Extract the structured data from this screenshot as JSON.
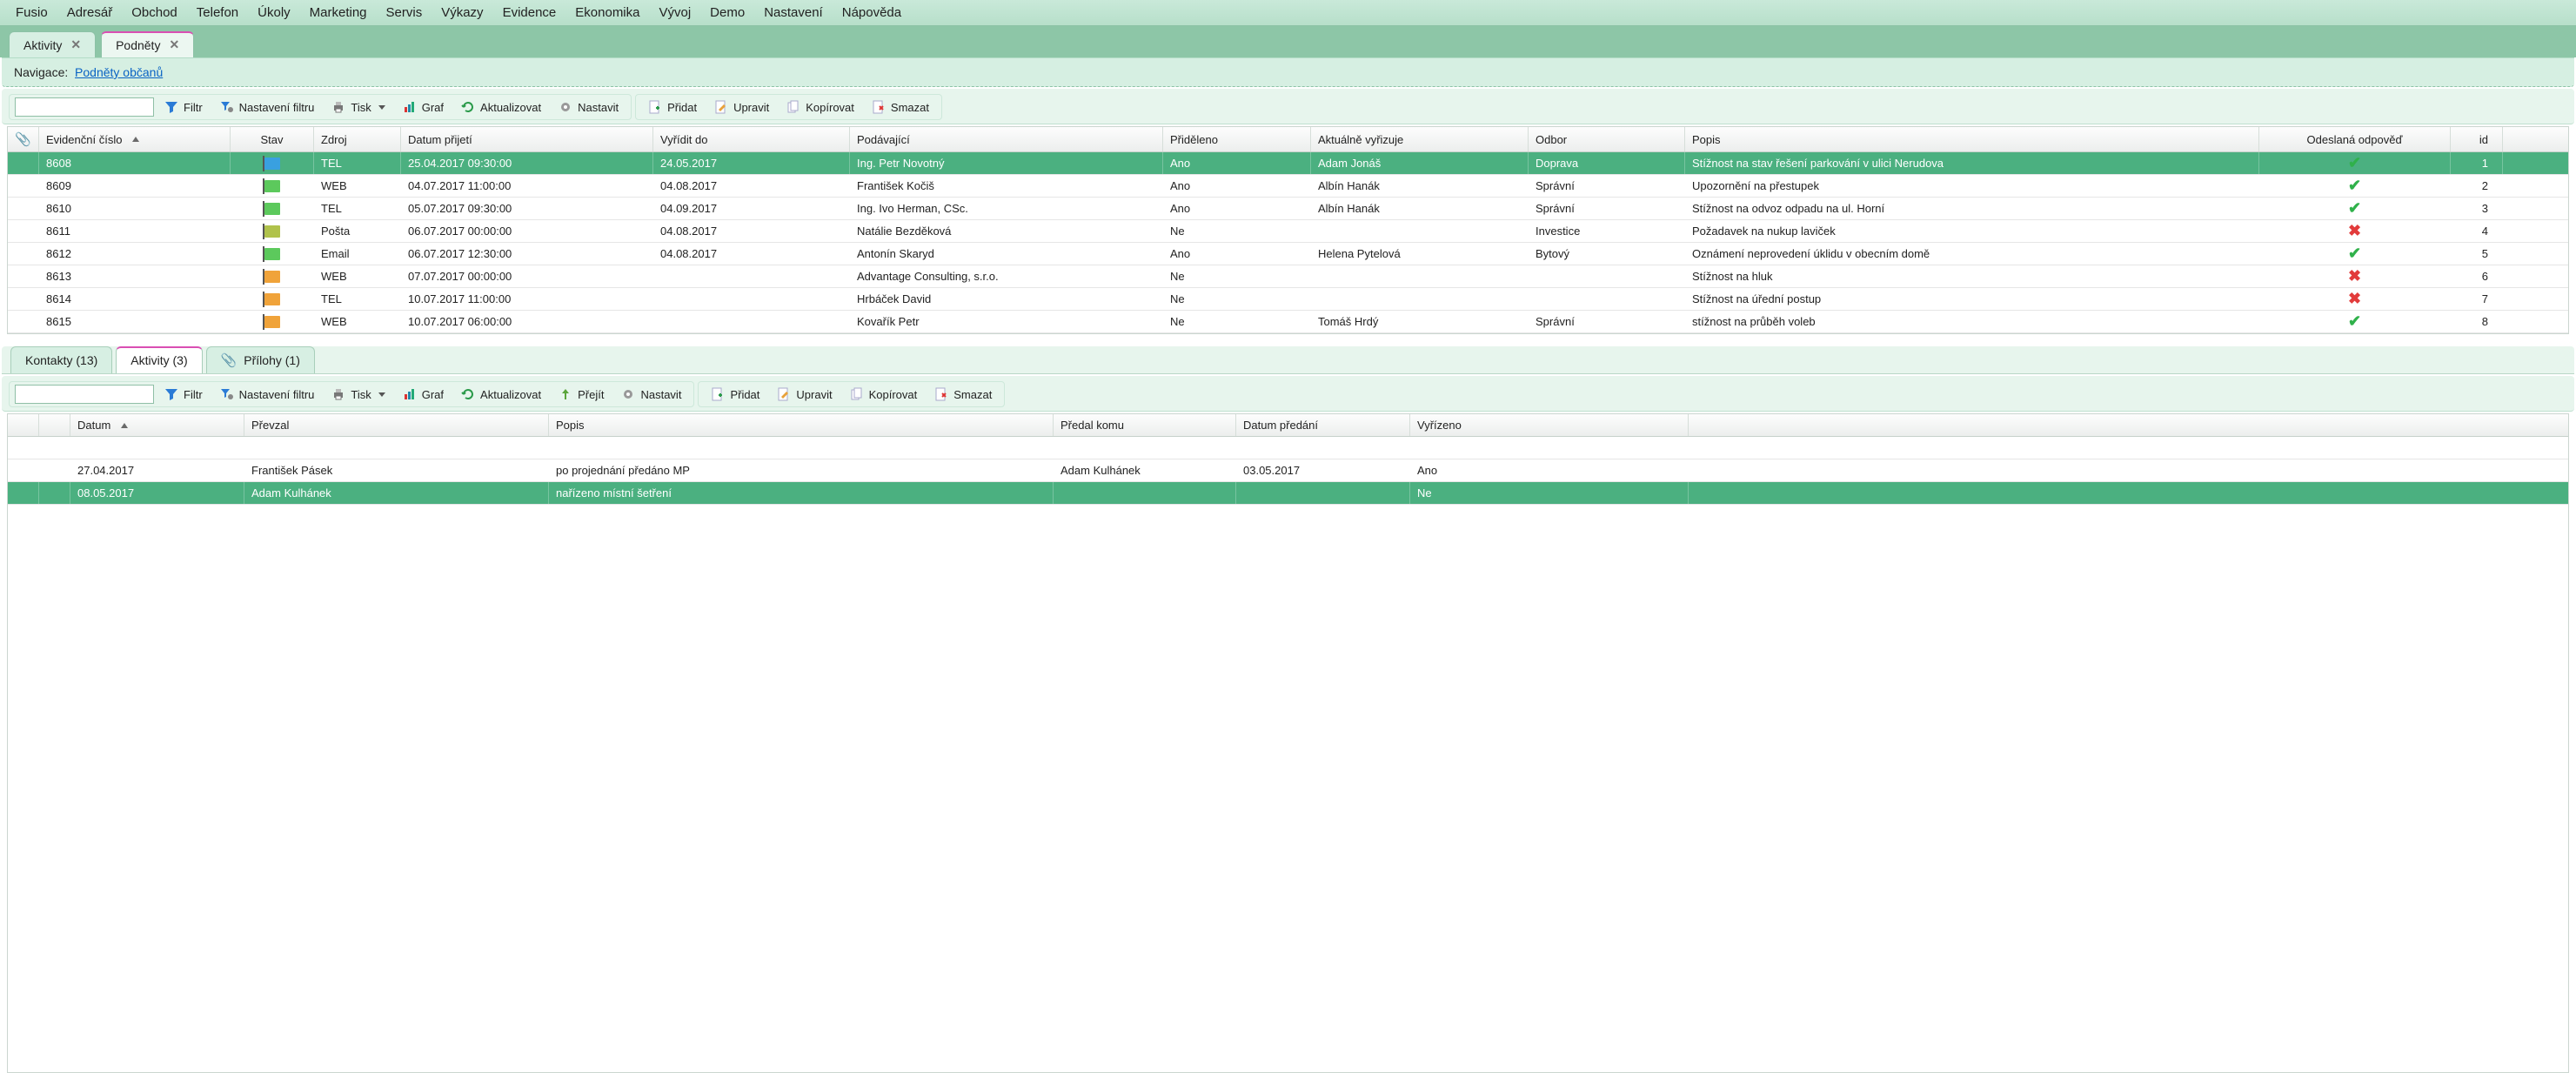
{
  "menu": {
    "items": [
      "Fusio",
      "Adresář",
      "Obchod",
      "Telefon",
      "Úkoly",
      "Marketing",
      "Servis",
      "Výkazy",
      "Evidence",
      "Ekonomika",
      "Vývoj",
      "Demo",
      "Nastavení",
      "Nápověda"
    ]
  },
  "module_tabs": {
    "active_index": 1,
    "tabs": [
      {
        "label": "Aktivity",
        "close": true
      },
      {
        "label": "Podněty",
        "close": true
      }
    ]
  },
  "navigation": {
    "label": "Navigace:",
    "link": "Podněty občanů"
  },
  "toolbar_main": {
    "filter": "Filtr",
    "filter_settings": "Nastavení filtru",
    "print": "Tisk",
    "graph": "Graf",
    "refresh": "Aktualizovat",
    "settings": "Nastavit",
    "add": "Přidat",
    "edit": "Upravit",
    "copy": "Kopírovat",
    "delete": "Smazat"
  },
  "main_grid": {
    "columns": {
      "clip": "",
      "ev": "Evidenční číslo",
      "stav": "Stav",
      "zdroj": "Zdroj",
      "dprij": "Datum přijetí",
      "vyr": "Vyřídit do",
      "pod": "Podávající",
      "prid": "Přiděleno",
      "akt": "Aktuálně vyřizuje",
      "odb": "Odbor",
      "popis": "Popis",
      "odes": "Odeslaná odpověď",
      "id": "id"
    },
    "rows": [
      {
        "selected": true,
        "ev": "8608",
        "flag": "blue",
        "zdroj": "TEL",
        "dprij": "25.04.2017 09:30:00",
        "vyr": "24.05.2017",
        "vyr_red": true,
        "pod": "Ing. Petr Novotný",
        "prid": "Ano",
        "akt": "Adam Jonáš",
        "odb": "Doprava",
        "popis": "Stížnost na stav řešení parkování v ulici Nerudova",
        "odes": true,
        "id": "1"
      },
      {
        "ev": "8609",
        "flag": "green",
        "zdroj": "WEB",
        "dprij": "04.07.2017 11:00:00",
        "vyr": "04.08.2017",
        "pod": "František Kočiš",
        "prid": "Ano",
        "akt": "Albín  Hanák",
        "odb": "Správní",
        "popis": "Upozornění na přestupek",
        "odes": true,
        "id": "2"
      },
      {
        "ev": "8610",
        "flag": "green",
        "zdroj": "TEL",
        "dprij": "05.07.2017 09:30:00",
        "vyr": "04.09.2017",
        "pod": "Ing. Ivo Herman, CSc.",
        "prid": "Ano",
        "akt": "Albín  Hanák",
        "odb": "Správní",
        "popis": "Stížnost na odvoz odpadu na ul. Horní",
        "odes": true,
        "id": "3"
      },
      {
        "ev": "8611",
        "flag": "olive",
        "zdroj": "Pošta",
        "dprij": "06.07.2017 00:00:00",
        "vyr": "04.08.2017",
        "pod": "Natálie Bezděková",
        "prid": "Ne",
        "akt": "",
        "odb": "Investice",
        "popis": "Požadavek na nukup laviček",
        "odes": false,
        "id": "4"
      },
      {
        "ev": "8612",
        "flag": "green",
        "zdroj": "Email",
        "dprij": "06.07.2017 12:30:00",
        "vyr": "04.08.2017",
        "pod": "Antonín Skaryd",
        "prid": "Ano",
        "akt": "Helena  Pytelová",
        "odb": "Bytový",
        "popis": "Oznámení neprovedení úklidu v obecním domě",
        "odes": true,
        "id": "5"
      },
      {
        "ev": "8613",
        "flag": "orange",
        "zdroj": "WEB",
        "dprij": "07.07.2017 00:00:00",
        "vyr": "",
        "pod": "Advantage Consulting, s.r.o.",
        "prid": "Ne",
        "akt": "",
        "odb": "",
        "popis": "Stížnost na hluk",
        "odes": false,
        "id": "6"
      },
      {
        "ev": "8614",
        "flag": "orange",
        "zdroj": "TEL",
        "dprij": "10.07.2017 11:00:00",
        "vyr": "",
        "pod": "Hrbáček David",
        "prid": "Ne",
        "akt": "",
        "odb": "",
        "popis": "Stížnost na úřední postup",
        "odes": false,
        "id": "7"
      },
      {
        "ev": "8615",
        "flag": "orange",
        "zdroj": "WEB",
        "dprij": "10.07.2017 06:00:00",
        "vyr": "",
        "pod": "Kovařík Petr",
        "prid": "Ne",
        "akt": "Tomáš Hrdý",
        "odb": "Správní",
        "popis": "stížnost na průběh voleb",
        "odes": true,
        "id": "8"
      }
    ]
  },
  "sub_tabs": {
    "active_index": 1,
    "tabs": [
      {
        "label": "Kontakty (13)"
      },
      {
        "label": "Aktivity (3)"
      },
      {
        "label": "Přílohy (1)",
        "clip": true
      }
    ]
  },
  "toolbar_sub": {
    "filter": "Filtr",
    "filter_settings": "Nastavení filtru",
    "print": "Tisk",
    "graph": "Graf",
    "refresh": "Aktualizovat",
    "go": "Přejít",
    "settings": "Nastavit",
    "add": "Přidat",
    "edit": "Upravit",
    "copy": "Kopírovat",
    "delete": "Smazat"
  },
  "sub_grid": {
    "columns": {
      "datum": "Datum",
      "prev": "Převzal",
      "popis": "Popis",
      "predal": "Předal komu",
      "dpre": "Datum předání",
      "vyr": "Vyřízeno"
    },
    "rows": [
      {
        "datum": "27.04.2017",
        "prev": "František Pásek",
        "popis": "po projednání předáno MP",
        "predal": "Adam Kulhánek",
        "dpre": "03.05.2017",
        "vyr": "Ano"
      },
      {
        "selected": true,
        "datum": "08.05.2017",
        "prev": "Adam Kulhánek",
        "popis": "nařízeno místní šetření",
        "predal": "",
        "dpre": "",
        "vyr": "Ne"
      }
    ]
  }
}
